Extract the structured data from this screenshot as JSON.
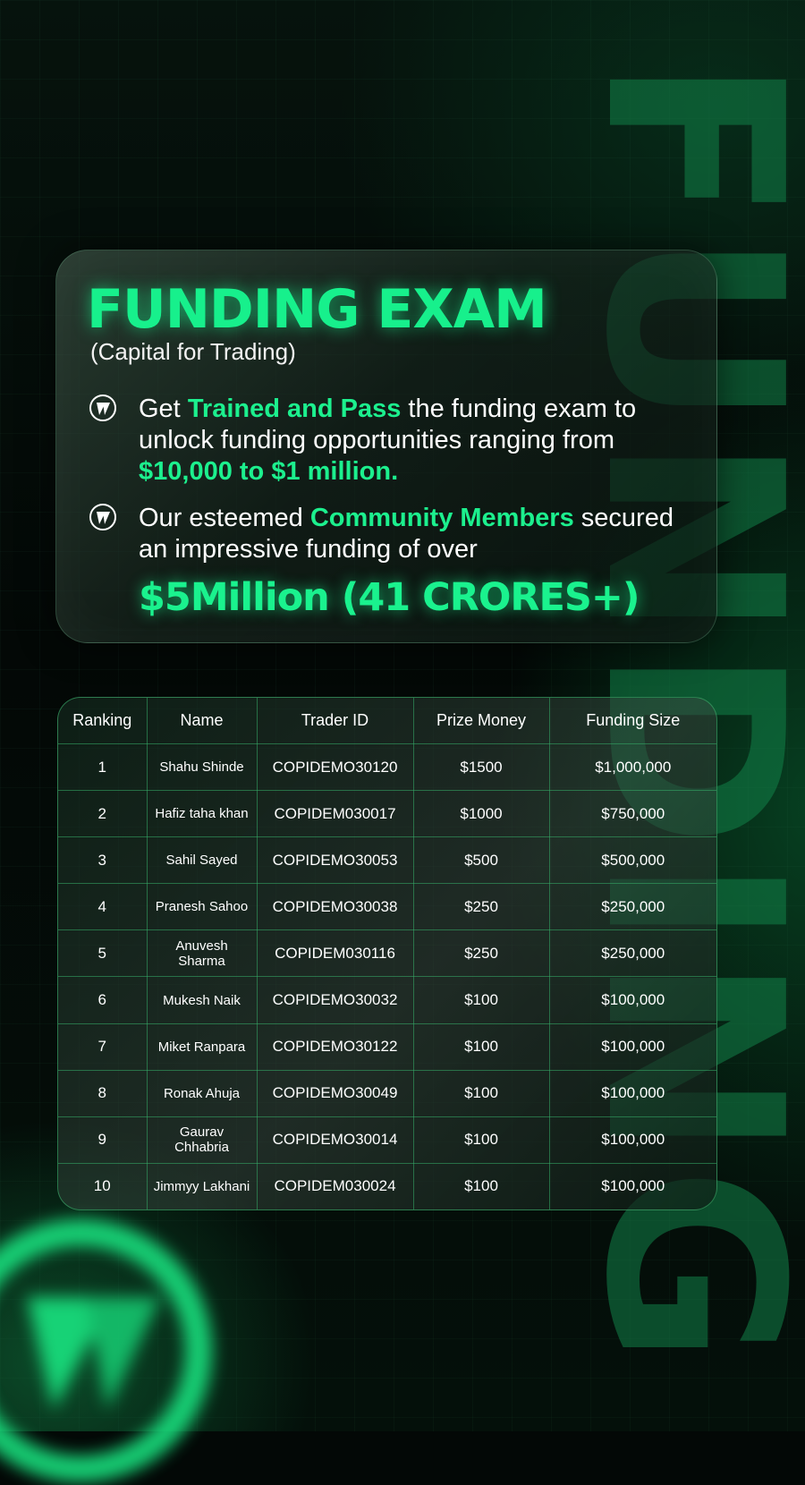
{
  "background_word": "FUNDING",
  "accent_color": "#17f08c",
  "exam_card": {
    "title": "FUNDING EXAM",
    "subtitle": "(Capital for Trading)",
    "bullet_icon": "brand-logo-icon",
    "bullet1": {
      "text_before": "Get ",
      "highlight": "Trained and Pass",
      "text_mid": " the funding exam to unlock funding opportunities ranging from ",
      "highlight2": "$10,000 to $1 million."
    },
    "bullet2": {
      "text_before": "Our esteemed ",
      "highlight": "Community Members",
      "text_after": " secured an impressive funding of over",
      "big_stat": "$5Million (41 CRORES+)"
    }
  },
  "table": {
    "headers": [
      "Ranking",
      "Name",
      "Trader ID",
      "Prize Money",
      "Funding Size"
    ],
    "rows": [
      [
        "1",
        "Shahu Shinde",
        "COPIDEMO30120",
        "$1500",
        "$1,000,000"
      ],
      [
        "2",
        "Hafiz taha khan",
        "COPIDEM030017",
        "$1000",
        "$750,000"
      ],
      [
        "3",
        "Sahil Sayed",
        "COPIDEMO30053",
        "$500",
        "$500,000"
      ],
      [
        "4",
        "Pranesh Sahoo",
        "COPIDEMO30038",
        "$250",
        "$250,000"
      ],
      [
        "5",
        "Anuvesh Sharma",
        "COPIDEM030116",
        "$250",
        "$250,000"
      ],
      [
        "6",
        "Mukesh Naik",
        "COPIDEMO30032",
        "$100",
        "$100,000"
      ],
      [
        "7",
        "Miket Ranpara",
        "COPIDEMO30122",
        "$100",
        "$100,000"
      ],
      [
        "8",
        "Ronak Ahuja",
        "COPIDEMO30049",
        "$100",
        "$100,000"
      ],
      [
        "9",
        "Gaurav Chhabria",
        "COPIDEMO30014",
        "$100",
        "$100,000"
      ],
      [
        "10",
        "Jimmyy Lakhani",
        "COPIDEM030024",
        "$100",
        "$100,000"
      ]
    ]
  }
}
